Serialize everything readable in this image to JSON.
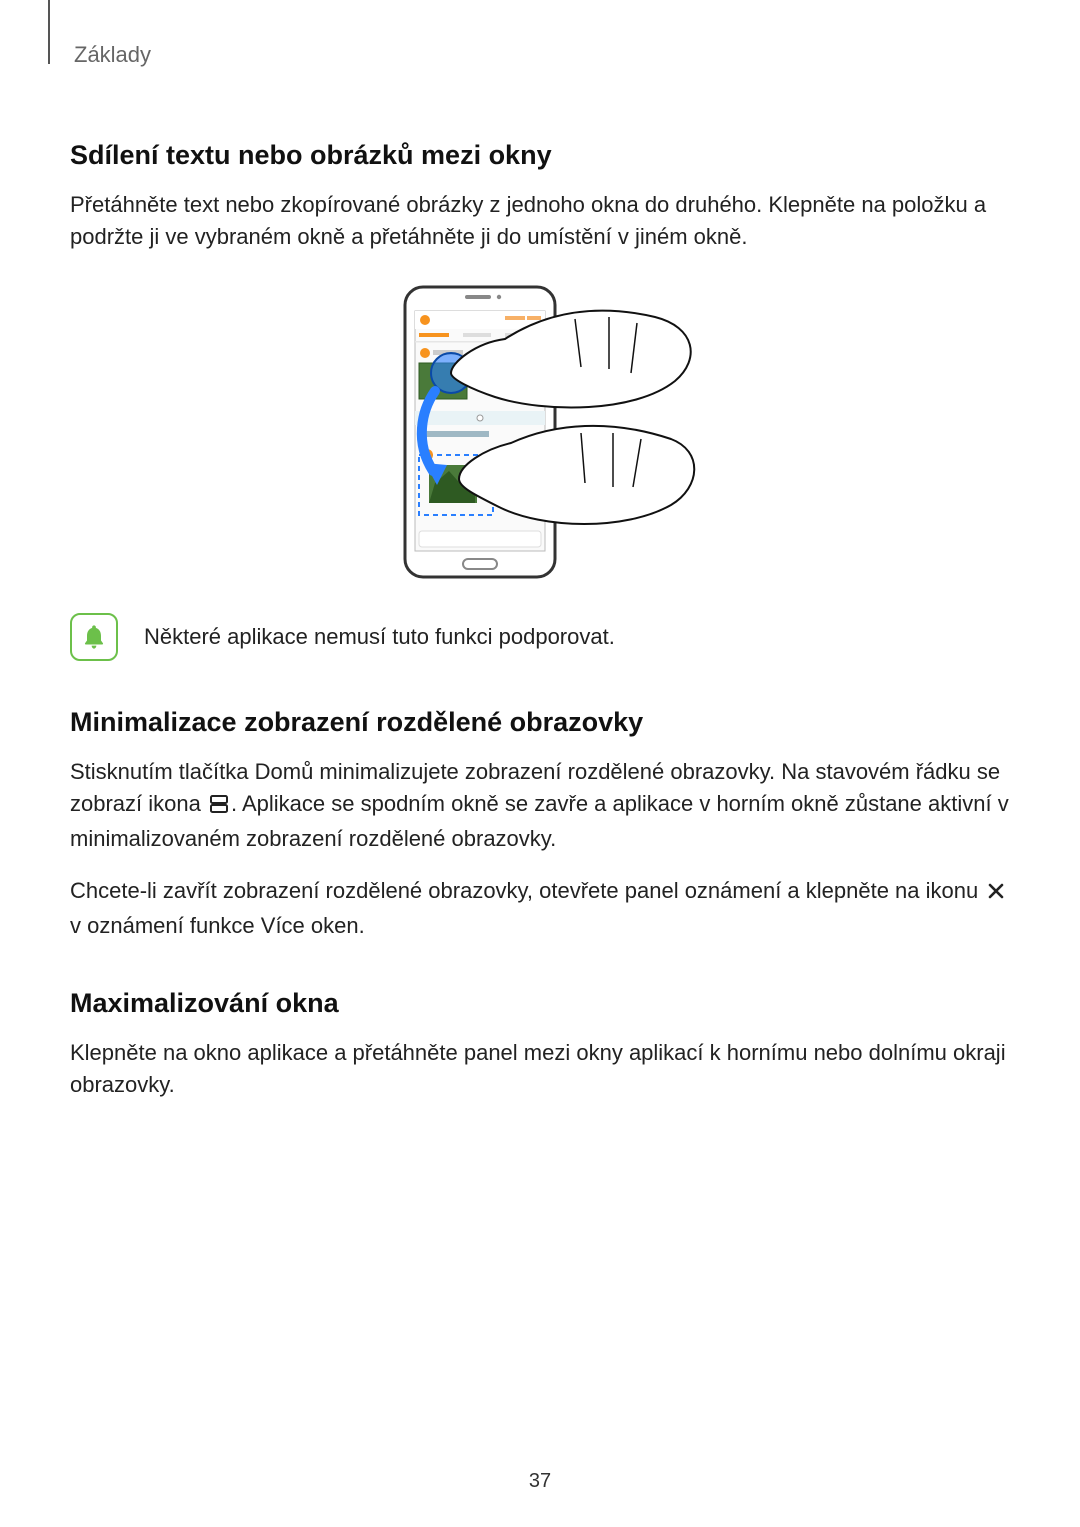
{
  "chapter": "Základy",
  "page_number": "37",
  "section1": {
    "heading": "Sdílení textu nebo obrázků mezi okny",
    "p1": "Přetáhněte text nebo zkopírované obrázky z jednoho okna do druhého. Klepněte na položku a podržte ji ve vybraném okně a přetáhněte ji do umístění v jiném okně."
  },
  "note": {
    "text": "Některé aplikace nemusí tuto funkci podporovat."
  },
  "section2": {
    "heading": "Minimalizace zobrazení rozdělené obrazovky",
    "p1a": "Stisknutím tlačítka Domů minimalizujete zobrazení rozdělené obrazovky. Na stavovém řádku se zobrazí ikona ",
    "p1b": ". Aplikace se spodním okně se zavře a aplikace v horním okně zůstane aktivní v minimalizovaném zobrazení rozdělené obrazovky.",
    "p2a": "Chcete-li zavřít zobrazení rozdělené obrazovky, otevřete panel oznámení a klepněte na ikonu ",
    "p2b": " v oznámení funkce Více oken."
  },
  "section3": {
    "heading": "Maximalizování okna",
    "p1": "Klepněte na okno aplikace a přetáhněte panel mezi okny aplikací k hornímu nebo dolnímu okraji obrazovky."
  }
}
